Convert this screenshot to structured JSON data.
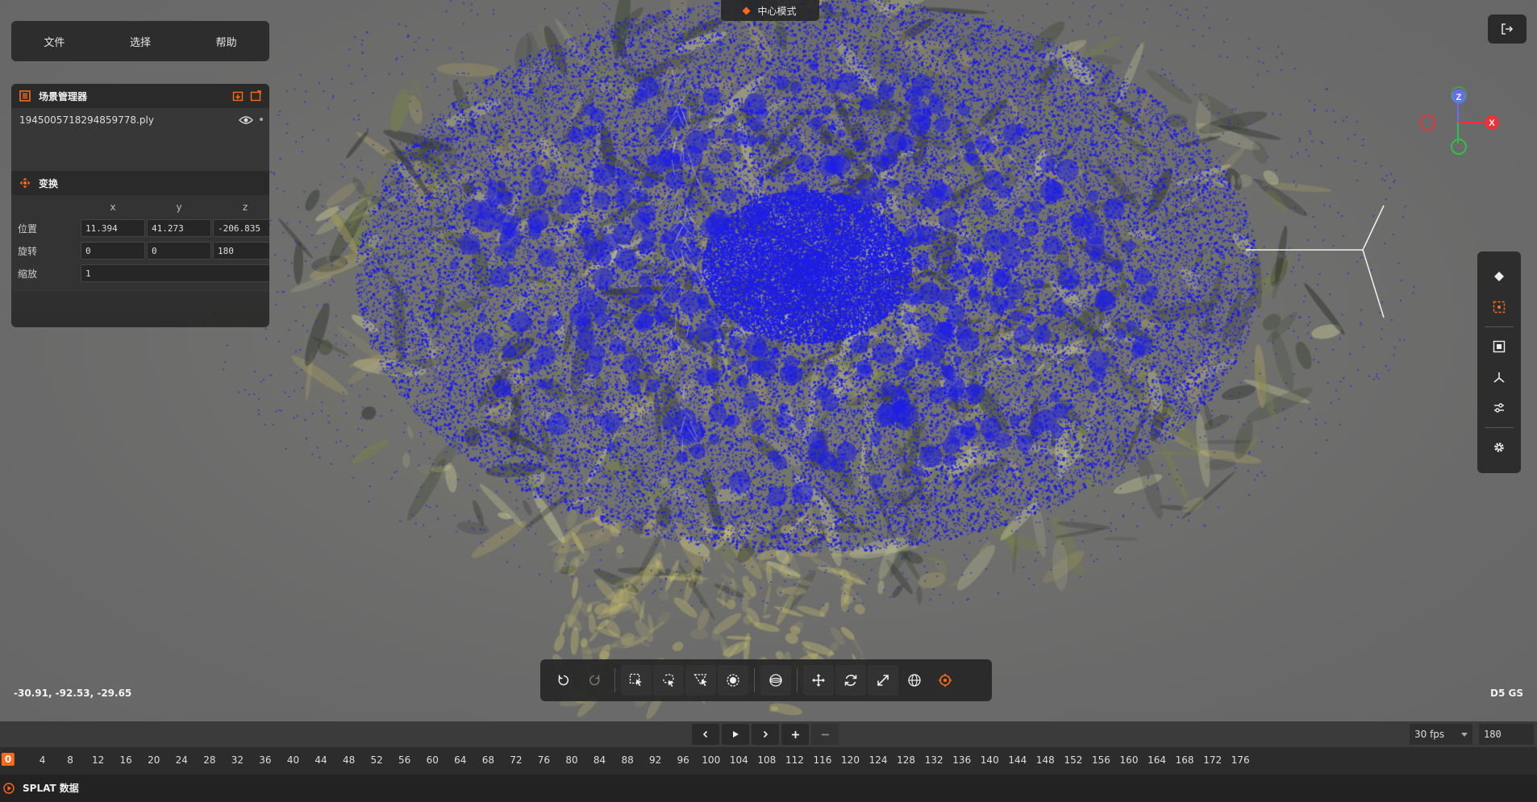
{
  "menu": {
    "items": [
      "文件",
      "选择",
      "帮助"
    ]
  },
  "mode_badge": "中心模式",
  "scene_manager": {
    "title": "场景管理器",
    "items": [
      {
        "name": "1945005718294859778.ply"
      }
    ]
  },
  "transform": {
    "title": "变换",
    "axes": [
      "x",
      "y",
      "z"
    ],
    "position_label": "位置",
    "rotation_label": "旋转",
    "scale_label": "缩放",
    "position": [
      "11.394",
      "41.273",
      "-206.835"
    ],
    "rotation": [
      "0",
      "0",
      "180"
    ],
    "scale": "1"
  },
  "gizmo": {
    "z_label": "Z",
    "x_label": "X"
  },
  "status": {
    "coords": "-30.91, -92.53, -29.65",
    "brand": "D5 GS"
  },
  "playback": {
    "fps": "30 fps",
    "total_frames": "180"
  },
  "timeline": {
    "current": "0",
    "ticks": [
      "4",
      "8",
      "12",
      "16",
      "20",
      "24",
      "28",
      "32",
      "36",
      "40",
      "44",
      "48",
      "52",
      "56",
      "60",
      "64",
      "68",
      "72",
      "76",
      "80",
      "84",
      "88",
      "92",
      "96",
      "100",
      "104",
      "108",
      "112",
      "116",
      "120",
      "124",
      "128",
      "132",
      "136",
      "140",
      "144",
      "148",
      "152",
      "156",
      "160",
      "164",
      "168",
      "172",
      "176"
    ],
    "track_label": "SPLAT 数据"
  },
  "colors": {
    "accent": "#ff6a1a",
    "splat_points": "#1e1ee6",
    "axis_x": "#e8333a",
    "axis_y": "#2fc04a",
    "axis_z": "#6a6af0"
  }
}
